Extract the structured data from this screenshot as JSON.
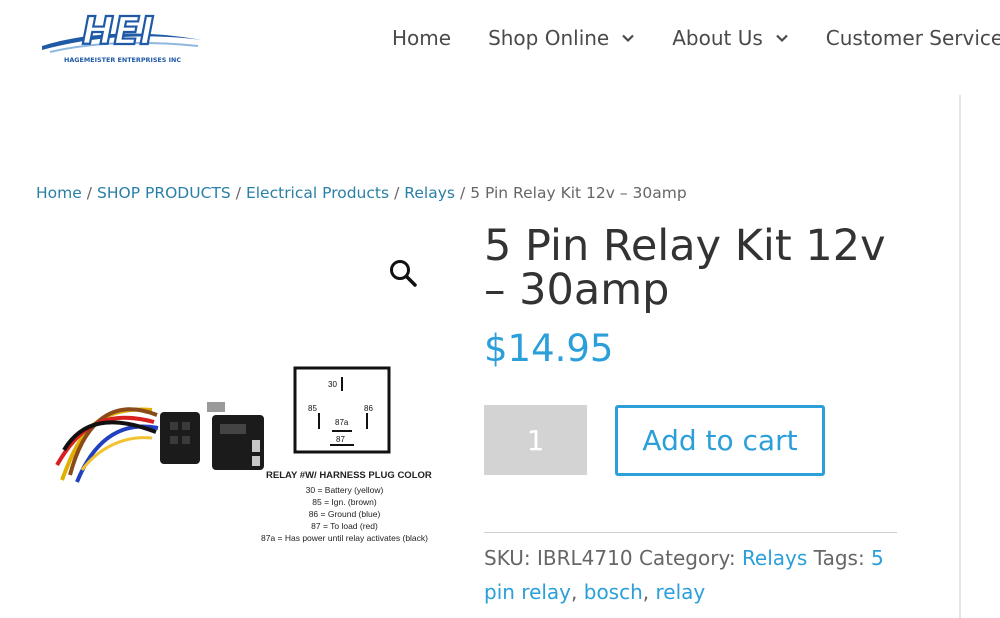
{
  "header": {
    "logo": {
      "wordmark": "HEI",
      "company": "HAGEMEISTER ENTERPRISES INC"
    },
    "nav": [
      {
        "label": "Home",
        "has_dropdown": false
      },
      {
        "label": "Shop Online",
        "has_dropdown": true
      },
      {
        "label": "About Us",
        "has_dropdown": true
      },
      {
        "label": "Customer Service",
        "has_dropdown": false
      }
    ]
  },
  "breadcrumb": {
    "items": [
      "Home",
      "SHOP PRODUCTS",
      "Electrical Products",
      "Relays"
    ],
    "current": "5 Pin Relay Kit 12v – 30amp",
    "separator": "/"
  },
  "product_image": {
    "zoom_icon": "magnifier-icon",
    "diagram_pins": [
      "30",
      "85",
      "87a",
      "86",
      "87"
    ],
    "diagram_title": "RELAY #W/ HARNESS PLUG COLOR",
    "legend": [
      "30 = Battery (yellow)",
      "85 = Ign. (brown)",
      "86 = Ground (blue)",
      "87 = To load (red)",
      "87a = Has power until relay activates (black)"
    ]
  },
  "product": {
    "title": "5 Pin Relay Kit 12v – 30amp",
    "price": "$14.95",
    "quantity": "1",
    "add_to_cart_label": "Add to cart"
  },
  "meta": {
    "sku_label": "SKU:",
    "sku": "IBRL4710",
    "category_label": "Category:",
    "category": "Relays",
    "tags_label": "Tags:",
    "tags": [
      "5 pin relay",
      "bosch",
      "relay"
    ],
    "tag_separator": ","
  },
  "colors": {
    "accent": "#2b9fd9",
    "link": "#2a7fa6",
    "text": "#666666",
    "heading": "#333333",
    "qty_bg": "#d3d3d3",
    "logo_blue": "#1f5aa6"
  }
}
